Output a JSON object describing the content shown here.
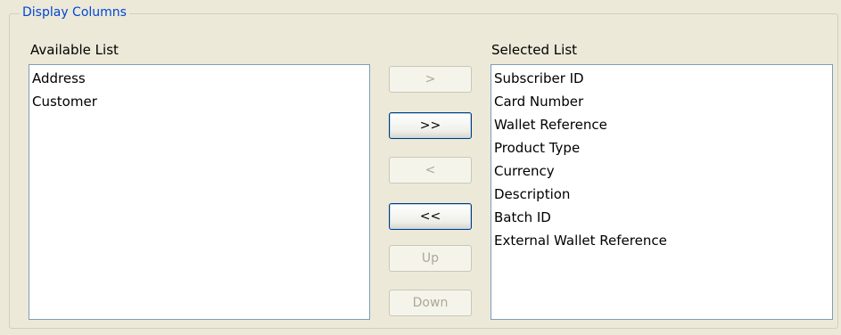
{
  "group": {
    "title": "Display Columns"
  },
  "available": {
    "header": "Available List",
    "items": [
      "Address",
      "Customer"
    ]
  },
  "selected": {
    "header": "Selected List",
    "items": [
      "Subscriber ID",
      "Card Number",
      "Wallet Reference",
      "Product Type",
      "Currency",
      "Description",
      "Batch ID",
      "External Wallet Reference"
    ]
  },
  "buttons": {
    "add": ">",
    "add_all": ">>",
    "remove": "<",
    "remove_all": "<<",
    "up": "Up",
    "down": "Down"
  }
}
